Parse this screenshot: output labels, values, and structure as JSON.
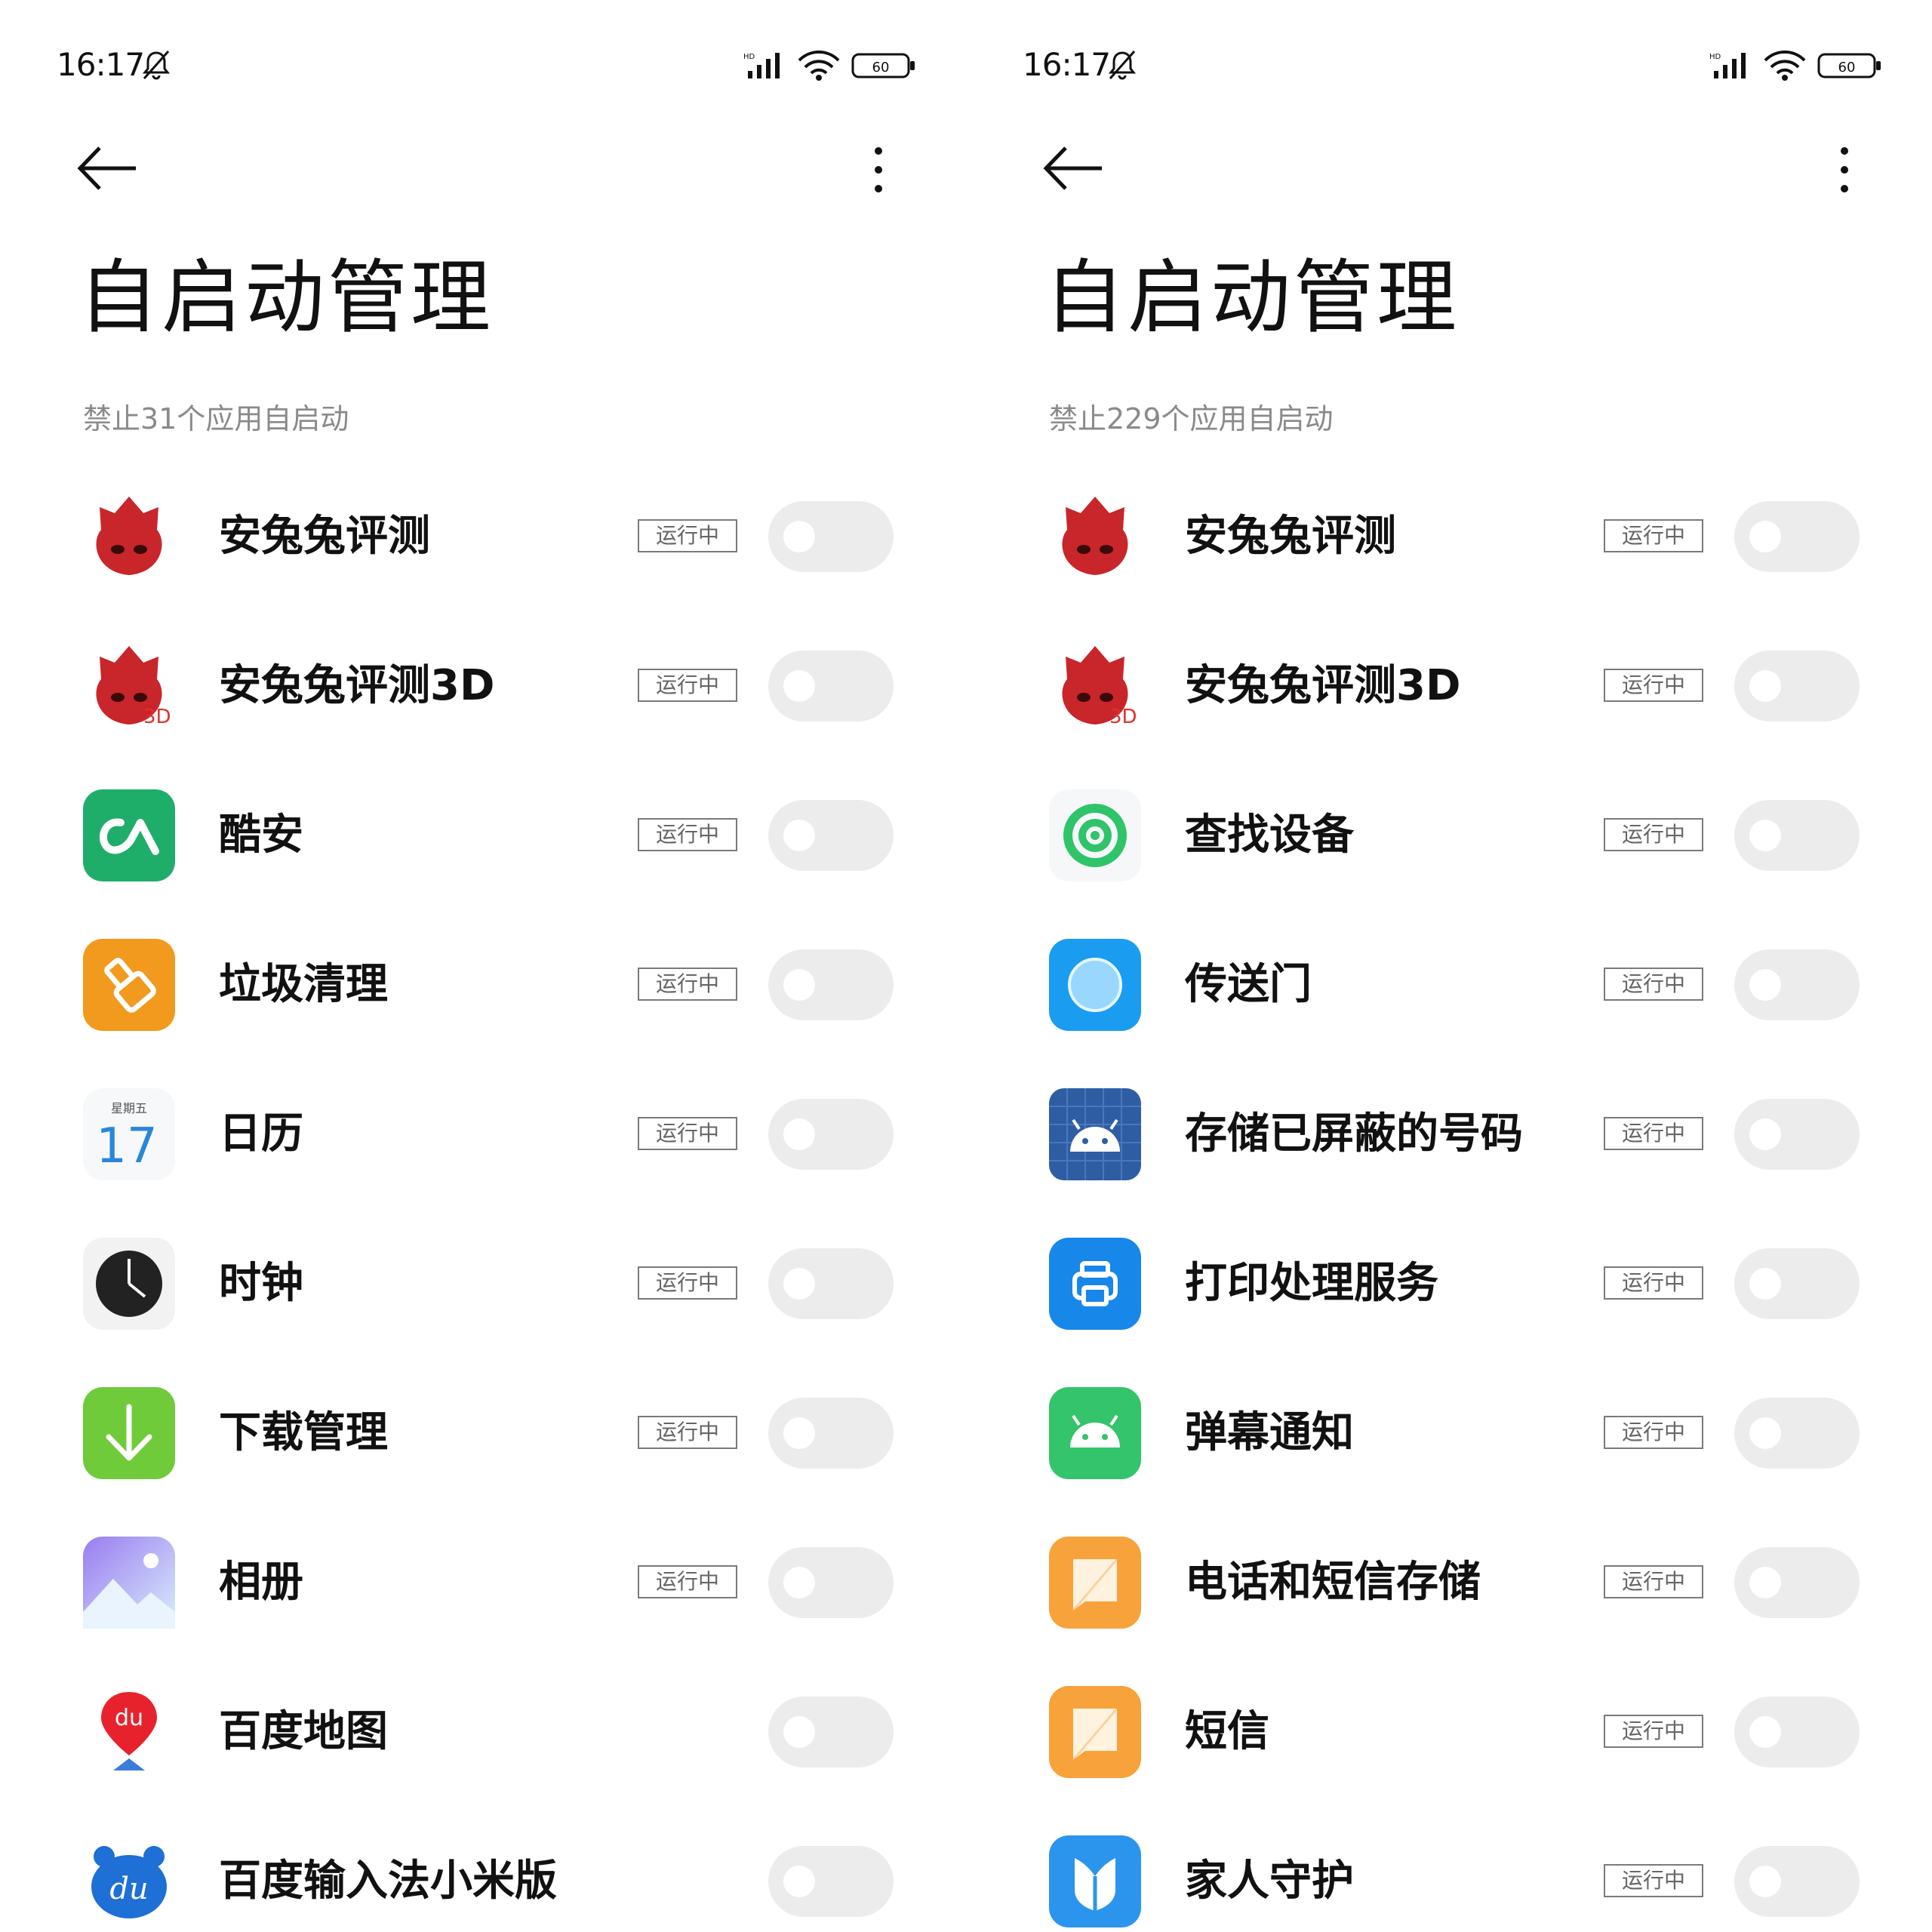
{
  "colors": {
    "title_text": "#111111",
    "summary_text": "#8a8a8a",
    "badge_border": "#7a7a7a",
    "toggle_off": "#ececec"
  },
  "panels": [
    {
      "status": {
        "time": "16:17"
      },
      "title": "自启动管理",
      "summary": "禁止31个应用自启动",
      "apps": [
        {
          "name": "安兔兔评测",
          "icon": "antutu-icon",
          "badge": "运行中",
          "enabled": false
        },
        {
          "name": "安兔兔评测3D",
          "icon": "antutu-3d-icon",
          "badge": "运行中",
          "enabled": false
        },
        {
          "name": "酷安",
          "icon": "coolapk-icon",
          "badge": "运行中",
          "enabled": false
        },
        {
          "name": "垃圾清理",
          "icon": "cleaner-icon",
          "badge": "运行中",
          "enabled": false
        },
        {
          "name": "日历",
          "icon": "calendar-icon",
          "badge": "运行中",
          "enabled": false,
          "icon_day": "17",
          "icon_weekday": "星期五"
        },
        {
          "name": "时钟",
          "icon": "clock-icon",
          "badge": "运行中",
          "enabled": false
        },
        {
          "name": "下载管理",
          "icon": "download-icon",
          "badge": "运行中",
          "enabled": false
        },
        {
          "name": "相册",
          "icon": "gallery-icon",
          "badge": "运行中",
          "enabled": false
        },
        {
          "name": "百度地图",
          "icon": "baidu-map-icon",
          "badge": "",
          "enabled": false
        },
        {
          "name": "百度输入法小米版",
          "icon": "baidu-input-icon",
          "badge": "",
          "enabled": false
        }
      ]
    },
    {
      "status": {
        "time": "16:17"
      },
      "title": "自启动管理",
      "summary": "禁止229个应用自启动",
      "apps": [
        {
          "name": "安兔兔评测",
          "icon": "antutu-icon",
          "badge": "运行中",
          "enabled": false
        },
        {
          "name": "安兔兔评测3D",
          "icon": "antutu-3d-icon",
          "badge": "运行中",
          "enabled": false
        },
        {
          "name": "查找设备",
          "icon": "find-device-icon",
          "badge": "运行中",
          "enabled": false
        },
        {
          "name": "传送门",
          "icon": "portal-icon",
          "badge": "运行中",
          "enabled": false
        },
        {
          "name": "存储已屏蔽的号码",
          "icon": "android-blocked-icon",
          "badge": "运行中",
          "enabled": false
        },
        {
          "name": "打印处理服务",
          "icon": "print-icon",
          "badge": "运行中",
          "enabled": false
        },
        {
          "name": "弹幕通知",
          "icon": "android-green-icon",
          "badge": "运行中",
          "enabled": false
        },
        {
          "name": "电话和短信存储",
          "icon": "message-storage-icon",
          "badge": "运行中",
          "enabled": false
        },
        {
          "name": "短信",
          "icon": "sms-icon",
          "badge": "运行中",
          "enabled": false
        },
        {
          "name": "家人守护",
          "icon": "family-guard-icon",
          "badge": "运行中",
          "enabled": false
        }
      ]
    }
  ]
}
